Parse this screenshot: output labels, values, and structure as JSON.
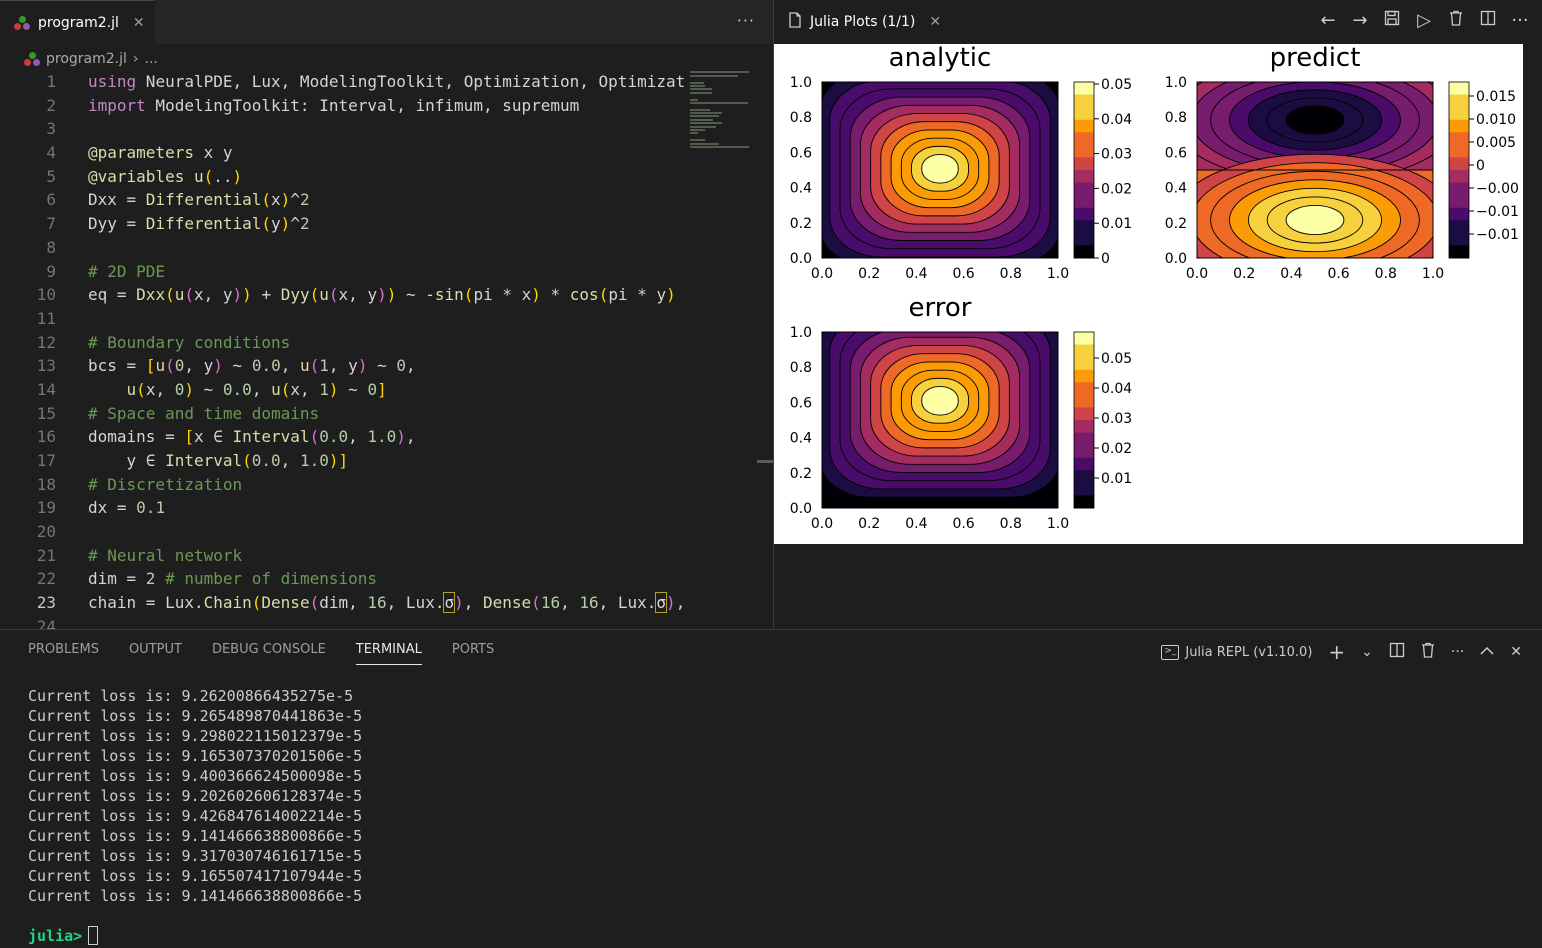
{
  "editor": {
    "tab": {
      "label": "program2.jl",
      "close": "✕"
    },
    "tabbar_more": "···",
    "breadcrumb": {
      "file": "program2.jl",
      "separator": "›",
      "rest": "..."
    },
    "lines": [
      {
        "n": "1",
        "text": "using NeuralPDE, Lux, ModelingToolkit, Optimization, Optimizat"
      },
      {
        "n": "2",
        "text": "import ModelingToolkit: Interval, infimum, supremum"
      },
      {
        "n": "3",
        "text": ""
      },
      {
        "n": "4",
        "text": "@parameters x y"
      },
      {
        "n": "5",
        "text": "@variables u(..)"
      },
      {
        "n": "6",
        "text": "Dxx = Differential(x)^2"
      },
      {
        "n": "7",
        "text": "Dyy = Differential(y)^2"
      },
      {
        "n": "8",
        "text": ""
      },
      {
        "n": "9",
        "text": "# 2D PDE"
      },
      {
        "n": "10",
        "text": "eq = Dxx(u(x, y)) + Dyy(u(x, y)) ~ -sin(pi * x) * cos(pi * y)"
      },
      {
        "n": "11",
        "text": ""
      },
      {
        "n": "12",
        "text": "# Boundary conditions"
      },
      {
        "n": "13",
        "text": "bcs = [u(0, y) ~ 0.0, u(1, y) ~ 0,"
      },
      {
        "n": "14",
        "text": "    u(x, 0) ~ 0.0, u(x, 1) ~ 0]"
      },
      {
        "n": "15",
        "text": "# Space and time domains"
      },
      {
        "n": "16",
        "text": "domains = [x ∈ Interval(0.0, 1.0),"
      },
      {
        "n": "17",
        "text": "    y ∈ Interval(0.0, 1.0)]"
      },
      {
        "n": "18",
        "text": "# Discretization"
      },
      {
        "n": "19",
        "text": "dx = 0.1"
      },
      {
        "n": "20",
        "text": ""
      },
      {
        "n": "21",
        "text": "# Neural network"
      },
      {
        "n": "22",
        "text": "dim = 2 # number of dimensions"
      },
      {
        "n": "23",
        "text": "chain = Lux.Chain(Dense(dim, 16, Lux.σ), Dense(16, 16, Lux.σ),"
      },
      {
        "n": "24",
        "text": ""
      }
    ]
  },
  "plots": {
    "tab": {
      "label": "Julia Plots (1/1)",
      "close": "✕"
    },
    "toolbar": {
      "back": "←",
      "forward": "→",
      "save": "💾",
      "run": "▷",
      "delete": "🗑",
      "split": "◫",
      "more": "···"
    },
    "subplots": [
      {
        "title": "analytic",
        "yticks": [
          "1.0",
          "0.8",
          "0.6",
          "0.4",
          "0.2",
          "0.0"
        ],
        "xticks": [
          "0.0",
          "0.2",
          "0.4",
          "0.6",
          "0.8",
          "1.0"
        ],
        "cbar_ticks": [
          "0.05",
          "0.04",
          "0.03",
          "0.02",
          "0.01",
          "0"
        ]
      },
      {
        "title": "predict",
        "yticks": [
          "1.0",
          "0.8",
          "0.6",
          "0.4",
          "0.2",
          "0.0"
        ],
        "xticks": [
          "0.0",
          "0.2",
          "0.4",
          "0.6",
          "0.8",
          "1.0"
        ],
        "cbar_ticks": [
          "0.015",
          "0.010",
          "0.005",
          "0",
          "−0.00",
          "−0.01",
          "−0.01"
        ]
      },
      {
        "title": "error",
        "yticks": [
          "1.0",
          "0.8",
          "0.6",
          "0.4",
          "0.2",
          "0.0"
        ],
        "xticks": [
          "0.0",
          "0.2",
          "0.4",
          "0.6",
          "0.8",
          "1.0"
        ],
        "cbar_ticks": [
          "0.05",
          "0.04",
          "0.03",
          "0.02",
          "0.01"
        ]
      }
    ],
    "colormap": [
      "#000004",
      "#1b0c41",
      "#4a0c6b",
      "#781c6d",
      "#a52c60",
      "#cf4446",
      "#ed6925",
      "#fb9b06",
      "#f7d13d",
      "#fcffa4"
    ]
  },
  "panel": {
    "tabs": [
      "PROBLEMS",
      "OUTPUT",
      "DEBUG CONSOLE",
      "TERMINAL",
      "PORTS"
    ],
    "active_tab": "TERMINAL",
    "repl_label": "Julia REPL (v1.10.0)",
    "actions": {
      "add": "+",
      "dropdown": "⌄",
      "split": "◫",
      "kill": "🗑",
      "more": "···",
      "maximize": "⌃",
      "close": "✕"
    },
    "terminal_lines": [
      "Current loss is: 9.26200866435275e-5",
      "Current loss is: 9.265489870441863e-5",
      "Current loss is: 9.298022115012379e-5",
      "Current loss is: 9.165307370201506e-5",
      "Current loss is: 9.400366624500098e-5",
      "Current loss is: 9.202602606128374e-5",
      "Current loss is: 9.426847614002214e-5",
      "Current loss is: 9.141466638800866e-5",
      "Current loss is: 9.317030746161715e-5",
      "Current loss is: 9.165507417107944e-5",
      "Current loss is: 9.141466638800866e-5"
    ],
    "prompt": "julia>"
  }
}
